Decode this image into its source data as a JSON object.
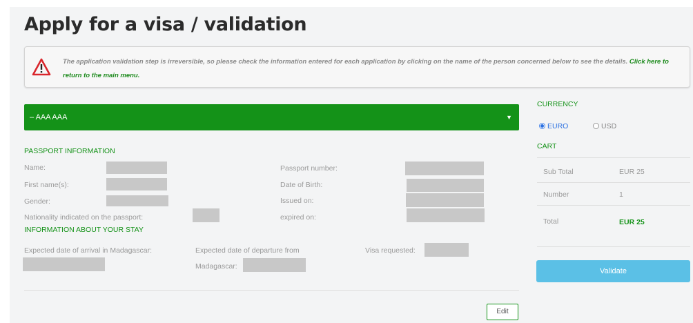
{
  "page": {
    "title": "Apply for a visa / validation"
  },
  "notice": {
    "text": "The application validation step is irreversible, so please check the information entered for each application by clicking on the name of the person concerned below to see the details.",
    "link": "Click here to return to the main menu."
  },
  "applicant": {
    "name": "– AAA AAA",
    "caret": "▼"
  },
  "passport": {
    "heading": "PASSPORT INFORMATION",
    "name_label": "Name:",
    "first_name_label": "First name(s):",
    "gender_label": "Gender:",
    "nationality_label": "Nationality indicated on the passport:",
    "passport_number_label": "Passport number:",
    "dob_label": "Date of Birth:",
    "issued_label": "Issued on:",
    "expired_label": "expired on:"
  },
  "stay": {
    "heading": "INFORMATION ABOUT YOUR STAY",
    "arrival_label": "Expected date of arrival in Madagascar:",
    "departure_label_1": "Expected date of departure from",
    "departure_label_2": "Madagascar:",
    "visa_label": "Visa requested:"
  },
  "edit_button": "Edit",
  "currency": {
    "heading": "CURRENCY",
    "options": [
      "EURO",
      "USD"
    ],
    "selected": "EURO"
  },
  "cart": {
    "heading": "CART",
    "rows": [
      {
        "label": "Sub Total",
        "value": "EUR 25"
      },
      {
        "label": "Number",
        "value": "1"
      },
      {
        "label": "Total",
        "value": "EUR 25"
      }
    ]
  },
  "validate_button": "Validate",
  "colors": {
    "accent_green": "#149218",
    "validate_blue": "#5bc0e6",
    "warning_red": "#d9262c"
  }
}
